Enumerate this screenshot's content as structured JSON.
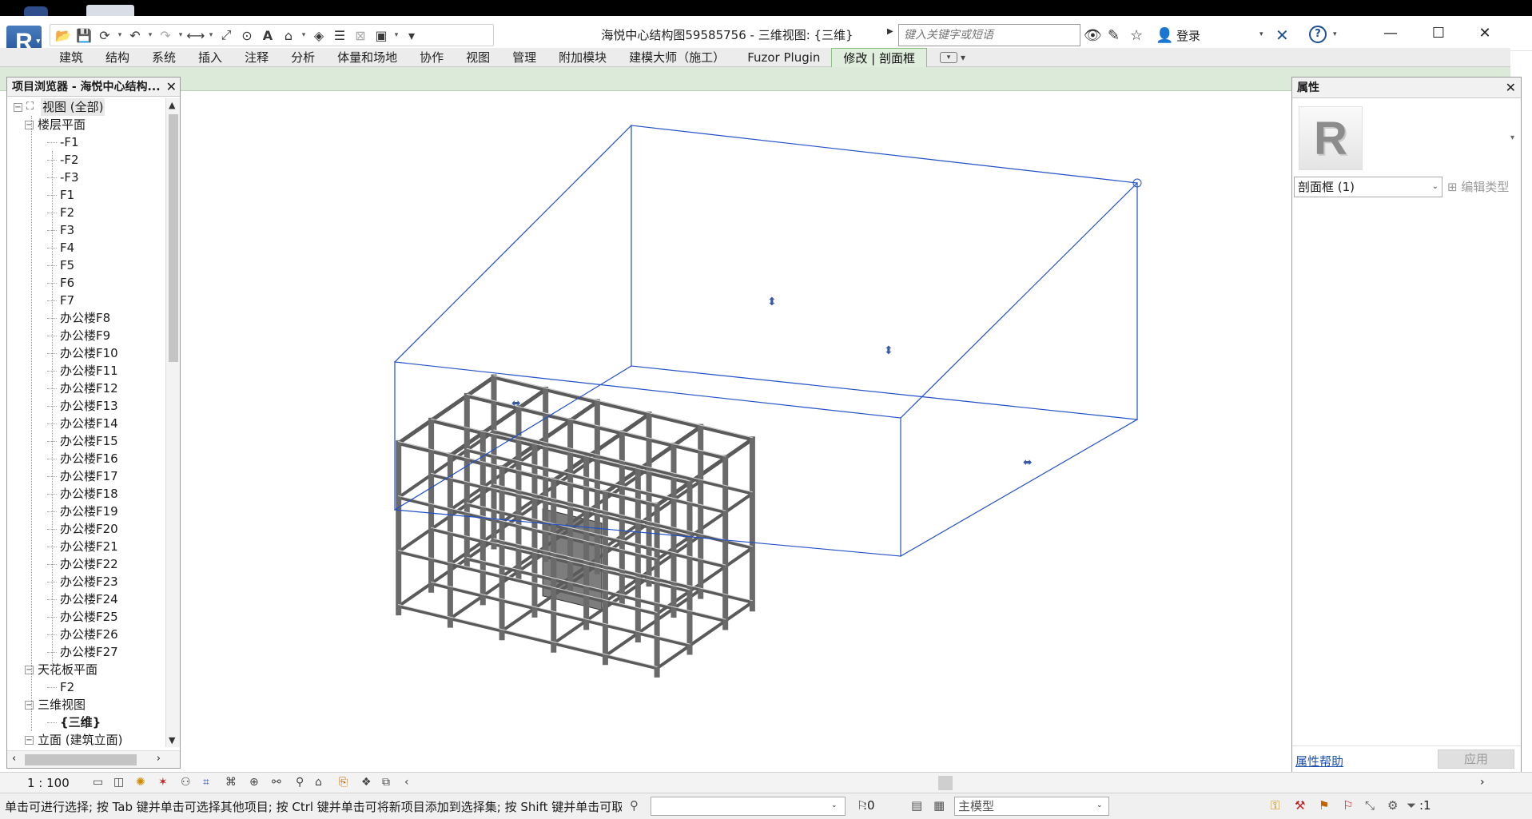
{
  "app": {
    "logo_letter": "R",
    "window_title": "海悦中心结构图59585756 - 三维视图: {三维}",
    "search_placeholder": "键入关键字或短语",
    "login_label": "登录",
    "help_symbol": "?",
    "win_minimize": "—",
    "win_maximize": "☐",
    "win_close": "✕"
  },
  "ribbon": {
    "tabs": [
      "建筑",
      "结构",
      "系统",
      "插入",
      "注释",
      "分析",
      "体量和场地",
      "协作",
      "视图",
      "管理",
      "附加模块",
      "建模大师（施工）",
      "Fuzor Plugin",
      "修改 | 剖面框"
    ],
    "active_tab": "修改 | 剖面框"
  },
  "browser": {
    "title": "项目浏览器 - 海悦中心结构...",
    "root": "视图 (全部)",
    "floor_plans": {
      "label": "楼层平面",
      "items": [
        "-F1",
        "-F2",
        "-F3",
        "F1",
        "F2",
        "F3",
        "F4",
        "F5",
        "F6",
        "F7",
        "办公楼F8",
        "办公楼F9",
        "办公楼F10",
        "办公楼F11",
        "办公楼F12",
        "办公楼F13",
        "办公楼F14",
        "办公楼F15",
        "办公楼F16",
        "办公楼F17",
        "办公楼F18",
        "办公楼F19",
        "办公楼F20",
        "办公楼F21",
        "办公楼F22",
        "办公楼F23",
        "办公楼F24",
        "办公楼F25",
        "办公楼F26",
        "办公楼F27"
      ]
    },
    "ceiling_plans": {
      "label": "天花板平面",
      "items": [
        "F2"
      ]
    },
    "views_3d": {
      "label": "三维视图",
      "items": [
        "{三维}"
      ]
    },
    "elevations": {
      "label": "立面 (建筑立面)"
    }
  },
  "properties": {
    "title": "属性",
    "type_thumb_letter": "R",
    "type_selector": "剖面框 (1)",
    "edit_type": "编辑类型",
    "help_link": "属性帮助",
    "apply": "应用"
  },
  "viewbar": {
    "scale": "1 : 100"
  },
  "statusbar": {
    "text": "单击可进行选择; 按 Tab 键并单击可选择其他项目; 按 Ctrl 键并单击可将新项目添加到选择集; 按 Shift 键并单击可取消",
    "selection_count": ":0",
    "model_label": "主模型",
    "filter_count": ":1"
  },
  "colors": {
    "section_box": "#2250c8",
    "ribbon_panel": "#dcead9",
    "active_tab_border": "#8cbf83",
    "structure": "#5a5a5a"
  }
}
